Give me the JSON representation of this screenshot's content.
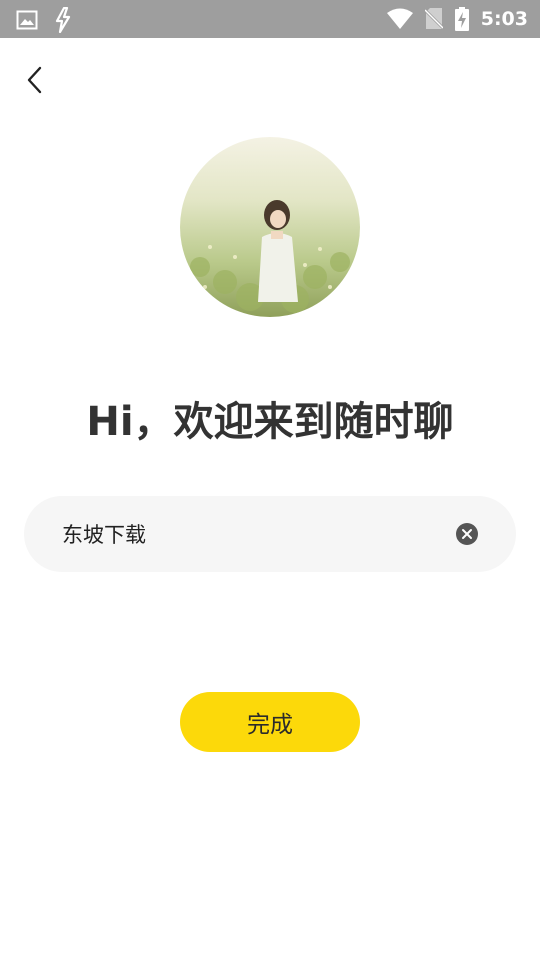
{
  "status_bar": {
    "time": "5:03",
    "icons": [
      "image-icon",
      "bolt-icon",
      "wifi-icon",
      "no-sim-icon",
      "battery-charging-icon"
    ]
  },
  "nav": {
    "back_icon": "chevron-left-icon"
  },
  "greeting": "Hi，欢迎来到随时聊",
  "name_input": {
    "value": "东坡下载"
  },
  "done_button": {
    "label": "完成"
  },
  "colors": {
    "accent": "#fcd90a",
    "status_bar": "#9e9e9e",
    "input_bg": "#f6f6f6",
    "title_text": "#333333"
  }
}
